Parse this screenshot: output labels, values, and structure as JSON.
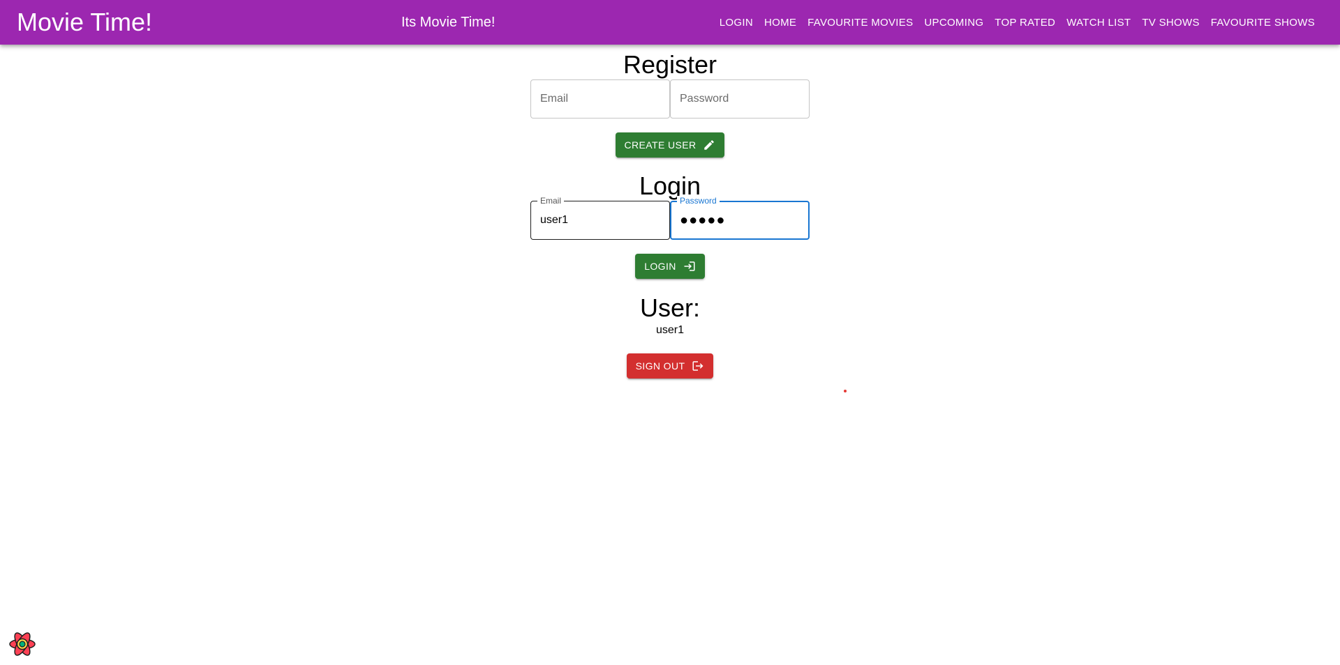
{
  "header": {
    "brand": "Movie Time!",
    "tagline": "Its Movie Time!",
    "nav": [
      "Login",
      "Home",
      "Favourite Movies",
      "Upcoming",
      "Top Rated",
      "Watch List",
      "TV Shows",
      "Favourite Shows"
    ]
  },
  "register": {
    "heading": "Register",
    "email_placeholder": "Email",
    "password_placeholder": "Password",
    "button_label": "Create User"
  },
  "login": {
    "heading": "Login",
    "email_label": "Email",
    "email_value": "user1",
    "password_label": "Password",
    "password_value": "●●●●●",
    "button_label": "Login"
  },
  "user": {
    "heading": "User:",
    "name": "user1",
    "signout_label": "Sign Out"
  },
  "icons": {
    "create_user": "pencil-icon",
    "login": "login-icon",
    "signout": "logout-icon",
    "devtools": "react-query-devtools-logo-icon"
  },
  "colors": {
    "appbar": "#9c27b0",
    "success": "#2e7d32",
    "error": "#d32f2f",
    "focus": "#1976d2"
  }
}
